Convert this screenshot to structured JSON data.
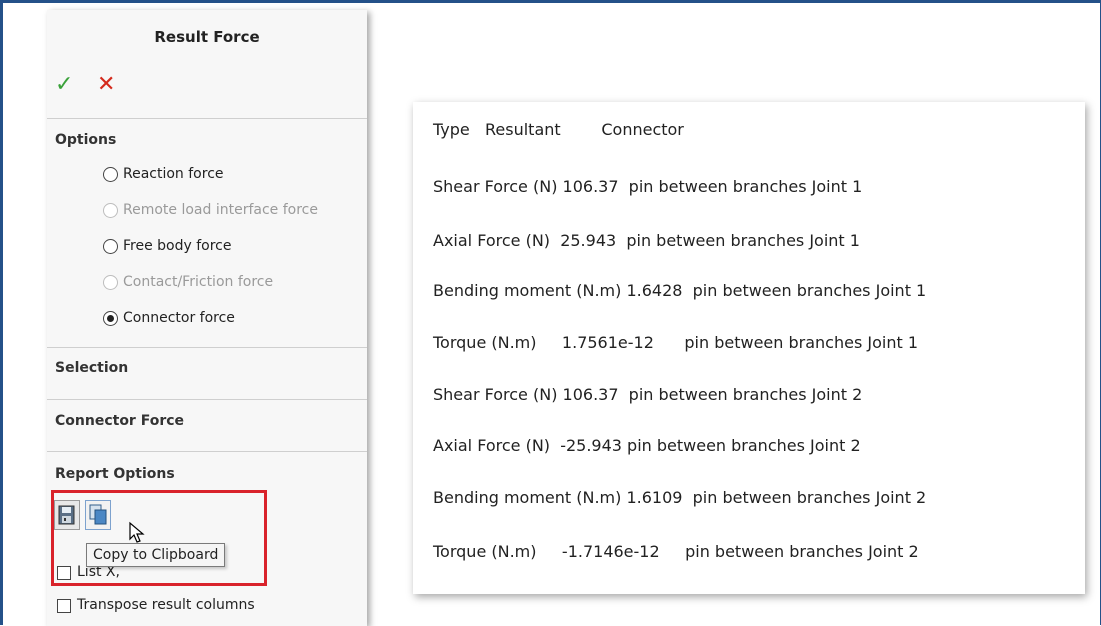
{
  "panel": {
    "title": "Result Force",
    "ok_icon": "checkmark-icon",
    "cancel_icon": "close-icon",
    "sections": {
      "options": "Options",
      "selection": "Selection",
      "connector_force": "Connector Force",
      "report_options": "Report Options"
    },
    "radios": [
      {
        "label": "Reaction force",
        "enabled": true,
        "selected": false
      },
      {
        "label": "Remote load interface force",
        "enabled": false,
        "selected": false
      },
      {
        "label": "Free body force",
        "enabled": true,
        "selected": false
      },
      {
        "label": "Contact/Friction force",
        "enabled": false,
        "selected": false
      },
      {
        "label": "Connector force",
        "enabled": true,
        "selected": true
      }
    ],
    "report_buttons": [
      {
        "icon": "save-icon"
      },
      {
        "icon": "copy-icon"
      }
    ],
    "tooltip": "Copy to Clipboard",
    "checkboxes": [
      {
        "label": "List X,",
        "checked": false
      },
      {
        "label": "Transpose result columns",
        "checked": false
      }
    ]
  },
  "results": {
    "header": "Type   Resultant        Connector",
    "rows": [
      "Shear Force (N) 106.37  pin between branches Joint 1",
      "Axial Force (N)  25.943  pin between branches Joint 1",
      "Bending moment (N.m) 1.6428  pin between branches Joint 1",
      "Torque (N.m)     1.7561e-12      pin between branches Joint 1",
      "Shear Force (N) 106.37  pin between branches Joint 2",
      "Axial Force (N)  -25.943 pin between branches Joint 2",
      "Bending moment (N.m) 1.6109  pin between branches Joint 2",
      "Torque (N.m)     -1.7146e-12     pin between branches Joint 2"
    ]
  },
  "colors": {
    "frame": "#245189",
    "highlight": "#d9232b",
    "ok": "#3aa23a",
    "cancel": "#d42a1c"
  }
}
